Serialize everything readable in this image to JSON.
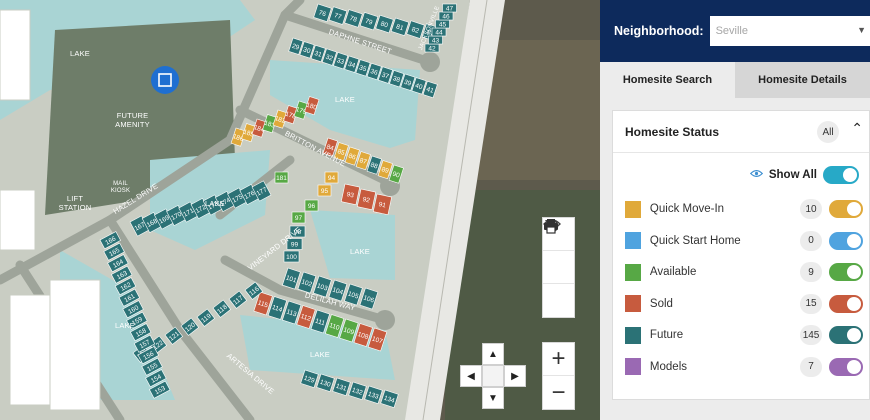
{
  "map": {
    "labels": {
      "lake_nw": "LAKE",
      "future_amenity": "FUTURE\nAMENITY",
      "lake_center": "LAKE",
      "mail_kiosk": "MAIL\nKIOSK",
      "lift_station": "LIFT\nSTATION",
      "hazel_drive": "HAZEL DRIVE",
      "lake_mid": "LAKE",
      "lake_east": "LAKE",
      "lake_sw": "LAKE",
      "lake_south": "LAKE",
      "daphne_street": "DAPHNE STREET",
      "britton_avenue": "BRITTON AVENUE",
      "vineyard_drive": "VINEYARD DRIVE",
      "delilah_way": "DELILAH WAY",
      "artesia_drive": "ARTESIA DRIVE",
      "jacksonville": "JACKSONVILLE"
    },
    "lots": [
      {
        "n": "76",
        "s": "future"
      },
      {
        "n": "77",
        "s": "future"
      },
      {
        "n": "78",
        "s": "future"
      },
      {
        "n": "79",
        "s": "future"
      },
      {
        "n": "80",
        "s": "future"
      },
      {
        "n": "81",
        "s": "future"
      },
      {
        "n": "82",
        "s": "future"
      },
      {
        "n": "83",
        "s": "future"
      },
      {
        "n": "29",
        "s": "future"
      },
      {
        "n": "30",
        "s": "future"
      },
      {
        "n": "31",
        "s": "future"
      },
      {
        "n": "32",
        "s": "future"
      },
      {
        "n": "33",
        "s": "future"
      },
      {
        "n": "34",
        "s": "future"
      },
      {
        "n": "35",
        "s": "future"
      },
      {
        "n": "36",
        "s": "future"
      },
      {
        "n": "37",
        "s": "future"
      },
      {
        "n": "38",
        "s": "future"
      },
      {
        "n": "39",
        "s": "future"
      },
      {
        "n": "40",
        "s": "future"
      },
      {
        "n": "41",
        "s": "future"
      },
      {
        "n": "42",
        "s": "future"
      },
      {
        "n": "43",
        "s": "future"
      },
      {
        "n": "44",
        "s": "future"
      },
      {
        "n": "45",
        "s": "future"
      },
      {
        "n": "46",
        "s": "future"
      },
      {
        "n": "47",
        "s": "future"
      },
      {
        "n": "48",
        "s": "future"
      },
      {
        "n": "49",
        "s": "future"
      },
      {
        "n": "50",
        "s": "future"
      },
      {
        "n": "51",
        "s": "future"
      },
      {
        "n": "52",
        "s": "future"
      },
      {
        "n": "53",
        "s": "future"
      },
      {
        "n": "54",
        "s": "future"
      },
      {
        "n": "55",
        "s": "future"
      },
      {
        "n": "56",
        "s": "future"
      },
      {
        "n": "57",
        "s": "future"
      },
      {
        "n": "178",
        "s": "sold"
      },
      {
        "n": "179",
        "s": "available"
      },
      {
        "n": "180",
        "s": "sold"
      },
      {
        "n": "181",
        "s": "available"
      },
      {
        "n": "182",
        "s": "quick"
      },
      {
        "n": "183",
        "s": "available"
      },
      {
        "n": "184",
        "s": "sold"
      },
      {
        "n": "185",
        "s": "quick"
      },
      {
        "n": "186",
        "s": "quick"
      },
      {
        "n": "84",
        "s": "sold"
      },
      {
        "n": "85",
        "s": "quick"
      },
      {
        "n": "86",
        "s": "quick"
      },
      {
        "n": "87",
        "s": "quick"
      },
      {
        "n": "88",
        "s": "future"
      },
      {
        "n": "89",
        "s": "quick"
      },
      {
        "n": "90",
        "s": "available"
      },
      {
        "n": "91",
        "s": "sold"
      },
      {
        "n": "92",
        "s": "sold"
      },
      {
        "n": "93",
        "s": "sold"
      },
      {
        "n": "94",
        "s": "quick"
      },
      {
        "n": "95",
        "s": "quick"
      },
      {
        "n": "96",
        "s": "available"
      },
      {
        "n": "97",
        "s": "available"
      },
      {
        "n": "98",
        "s": "future"
      },
      {
        "n": "99",
        "s": "future"
      },
      {
        "n": "100",
        "s": "future"
      },
      {
        "n": "101",
        "s": "future"
      },
      {
        "n": "102",
        "s": "future"
      },
      {
        "n": "103",
        "s": "future"
      },
      {
        "n": "104",
        "s": "future"
      },
      {
        "n": "105",
        "s": "future"
      },
      {
        "n": "106",
        "s": "future"
      },
      {
        "n": "107",
        "s": "sold"
      },
      {
        "n": "108",
        "s": "sold"
      },
      {
        "n": "109",
        "s": "available"
      },
      {
        "n": "110",
        "s": "available"
      },
      {
        "n": "111",
        "s": "future"
      },
      {
        "n": "112",
        "s": "sold"
      },
      {
        "n": "113",
        "s": "future"
      },
      {
        "n": "114",
        "s": "future"
      },
      {
        "n": "115",
        "s": "sold"
      },
      {
        "n": "116",
        "s": "future"
      },
      {
        "n": "117",
        "s": "future"
      },
      {
        "n": "118",
        "s": "future"
      },
      {
        "n": "119",
        "s": "future"
      },
      {
        "n": "120",
        "s": "future"
      },
      {
        "n": "121",
        "s": "future"
      },
      {
        "n": "122",
        "s": "future"
      },
      {
        "n": "123",
        "s": "future"
      },
      {
        "n": "167",
        "s": "future"
      },
      {
        "n": "168",
        "s": "future"
      },
      {
        "n": "169",
        "s": "future"
      },
      {
        "n": "170",
        "s": "future"
      },
      {
        "n": "171",
        "s": "future"
      },
      {
        "n": "172",
        "s": "future"
      },
      {
        "n": "173",
        "s": "future"
      },
      {
        "n": "174",
        "s": "future"
      },
      {
        "n": "175",
        "s": "future"
      },
      {
        "n": "176",
        "s": "future"
      },
      {
        "n": "177",
        "s": "future"
      },
      {
        "n": "166",
        "s": "future"
      },
      {
        "n": "165",
        "s": "future"
      },
      {
        "n": "164",
        "s": "future"
      },
      {
        "n": "163",
        "s": "future"
      },
      {
        "n": "162",
        "s": "future"
      },
      {
        "n": "161",
        "s": "future"
      },
      {
        "n": "160",
        "s": "future"
      },
      {
        "n": "159",
        "s": "future"
      },
      {
        "n": "158",
        "s": "future"
      },
      {
        "n": "157",
        "s": "future"
      },
      {
        "n": "156",
        "s": "future"
      },
      {
        "n": "155",
        "s": "future"
      },
      {
        "n": "154",
        "s": "future"
      },
      {
        "n": "153",
        "s": "future"
      },
      {
        "n": "129",
        "s": "future"
      },
      {
        "n": "130",
        "s": "future"
      },
      {
        "n": "131",
        "s": "future"
      },
      {
        "n": "132",
        "s": "future"
      },
      {
        "n": "133",
        "s": "future"
      },
      {
        "n": "134",
        "s": "future"
      }
    ],
    "controls": {
      "eye": "eye-icon",
      "reset": "rotate-ccw-icon",
      "print": "printer-icon",
      "zoom_in": "+",
      "zoom_out": "−",
      "pan_up": "▲",
      "pan_down": "▼",
      "pan_left": "◀",
      "pan_right": "▶"
    }
  },
  "sidebar": {
    "neighborhood_label": "Neighborhood:",
    "neighborhood_value": "Seville",
    "tabs": [
      {
        "label": "Homesite Search",
        "active": true
      },
      {
        "label": "Homesite Details",
        "active": false
      }
    ],
    "panel": {
      "title": "Homesite Status",
      "all_badge": "All",
      "show_all_label": "Show All",
      "statuses": [
        {
          "name": "Quick Move-In",
          "count": "10",
          "color": "#e0a93a"
        },
        {
          "name": "Quick Start Home",
          "count": "0",
          "color": "#4fa3df"
        },
        {
          "name": "Available",
          "count": "9",
          "color": "#57a845"
        },
        {
          "name": "Sold",
          "count": "15",
          "color": "#c75b3e"
        },
        {
          "name": "Future",
          "count": "145",
          "color": "#2b7276"
        },
        {
          "name": "Models",
          "count": "7",
          "color": "#9a69b3"
        }
      ]
    }
  },
  "colors": {
    "quick": "#e0a93a",
    "available": "#57a845",
    "sold": "#c75b3e",
    "future": "#2b7276",
    "models": "#9a69b3",
    "show_all_toggle": "#27a9c7"
  }
}
